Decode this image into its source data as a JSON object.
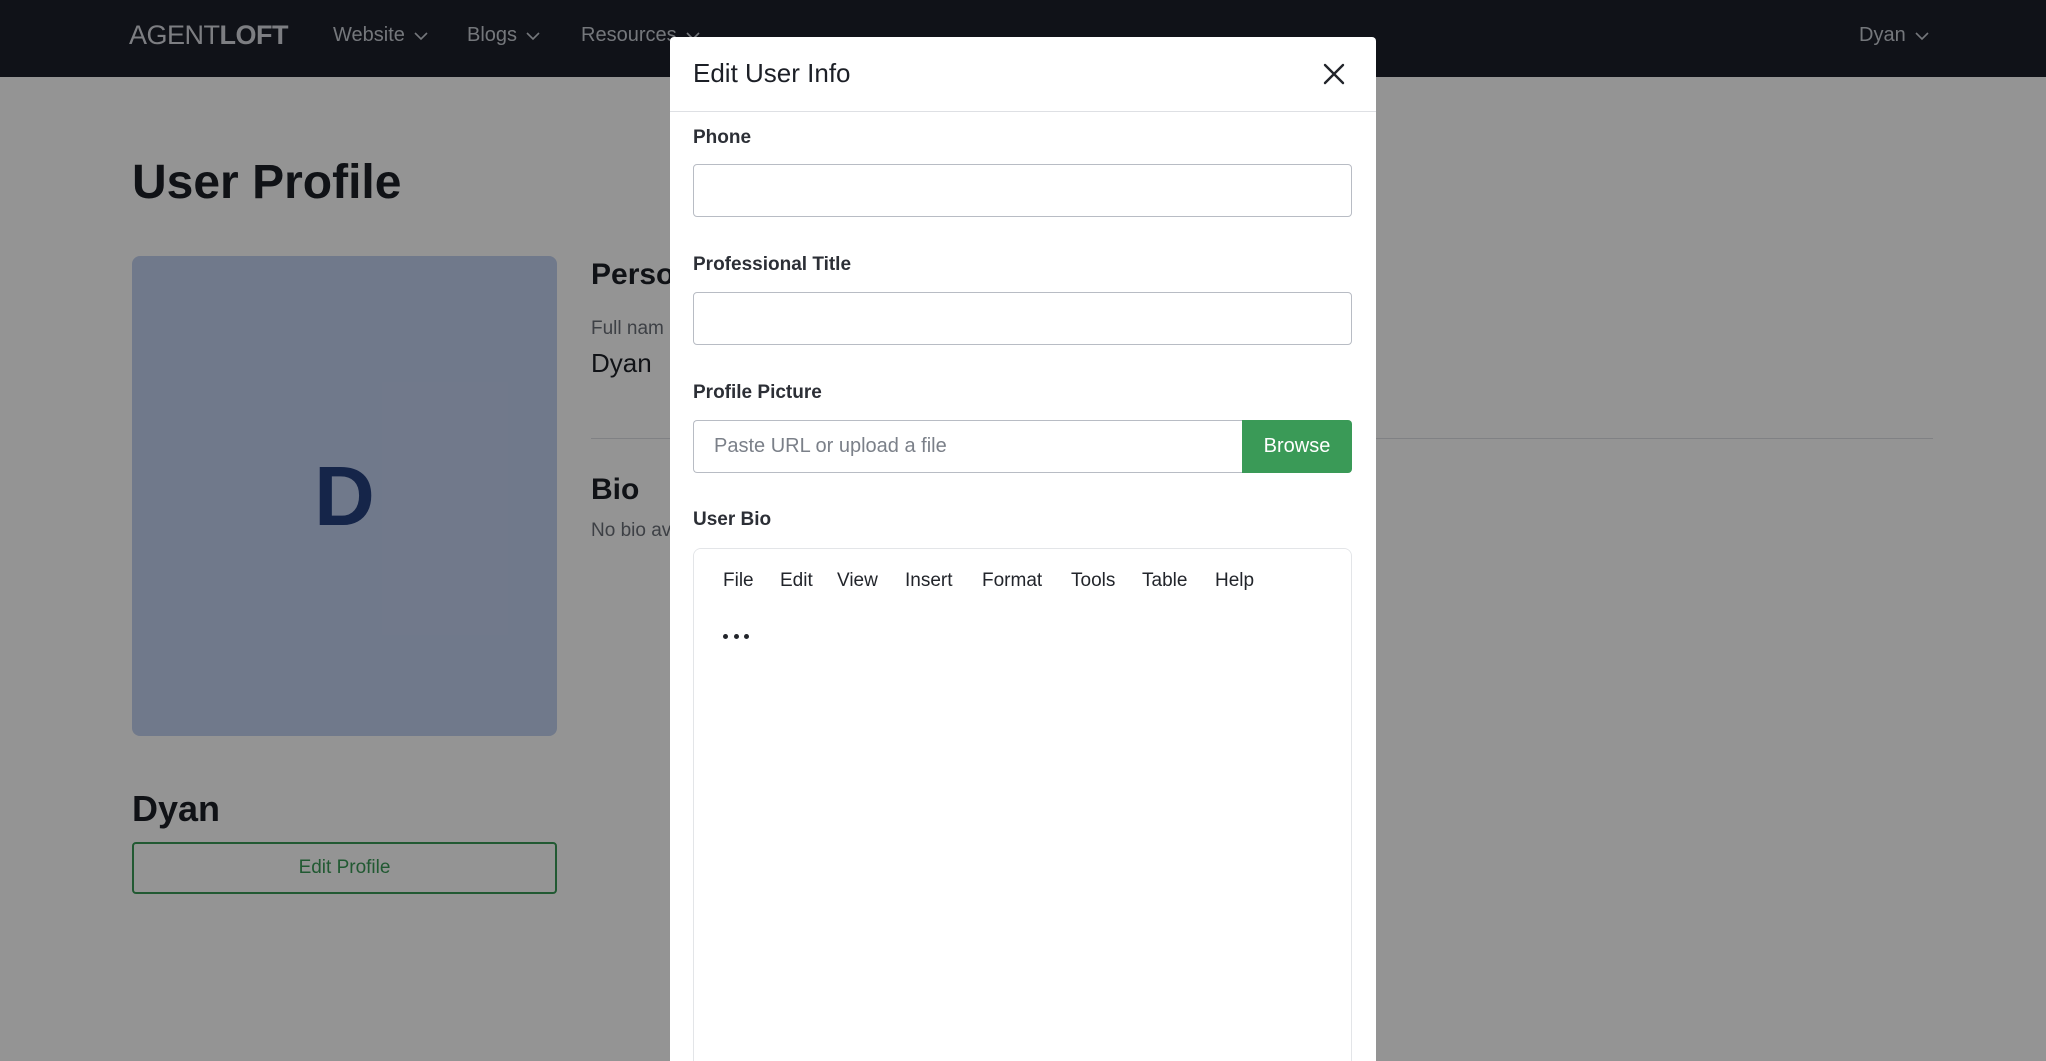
{
  "navbar": {
    "logo_light": "AGENT",
    "logo_bold": "LOFT",
    "menu": [
      {
        "label": "Website"
      },
      {
        "label": "Blogs"
      },
      {
        "label": "Resources"
      }
    ],
    "user_menu": "Dyan"
  },
  "profile": {
    "page_title": "User Profile",
    "avatar_letter": "D",
    "name": "Dyan",
    "edit_button": "Edit Profile",
    "personal_heading": "Perso",
    "full_name_label": "Full nam",
    "full_name_value": "Dyan",
    "bio_heading": "Bio",
    "bio_text": "No bio av"
  },
  "modal": {
    "title": "Edit User Info",
    "phone": {
      "label": "Phone",
      "value": ""
    },
    "professional_title": {
      "label": "Professional Title",
      "value": ""
    },
    "profile_picture": {
      "label": "Profile Picture",
      "placeholder": "Paste URL or upload a file",
      "browse_label": "Browse"
    },
    "user_bio": {
      "label": "User Bio",
      "menu": [
        "File",
        "Edit",
        "View",
        "Insert",
        "Format",
        "Tools",
        "Table",
        "Help"
      ]
    }
  },
  "colors": {
    "navbar_bg": "#1c1f2a",
    "accent_green": "#3a9a57",
    "avatar_bg": "#c2d1ef",
    "avatar_letter": "#25407f"
  },
  "icons": [
    "chevron-down-icon",
    "close-icon",
    "more-horizontal-icon"
  ]
}
